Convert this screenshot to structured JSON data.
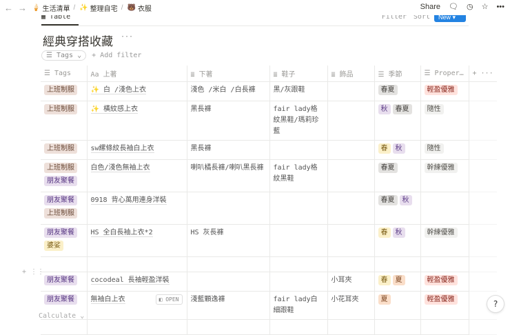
{
  "breadcrumb": [
    {
      "icon": "🍦",
      "label": "生活清單"
    },
    {
      "icon": "✨",
      "label": "整理自宅"
    },
    {
      "icon": "🐻",
      "label": "衣服"
    }
  ],
  "topbar": {
    "share": "Share"
  },
  "view": {
    "tab": "Table",
    "tools": "Filter Sort",
    "new": "New"
  },
  "title": "經典穿搭收藏",
  "filter": {
    "chip": "Tags",
    "add": "+ Add filter"
  },
  "columns": [
    "Tags",
    "上著",
    "下著",
    "鞋子",
    "飾品",
    "季節",
    "Proper…"
  ],
  "rows": [
    {
      "tags": [
        "上班制服"
      ],
      "top": "✨ 白 /淺色上衣",
      "bottom": "淺色 /米白 /白長褲",
      "shoes": "黑/灰跟鞋",
      "acc": "",
      "season": [
        "春夏"
      ],
      "prop": [
        "輕盈優雅"
      ]
    },
    {
      "tags": [
        "上班制服"
      ],
      "top": "✨ 橫紋感上衣",
      "bottom": "黑長褲",
      "shoes": "fair lady格紋黑鞋/瑪莉珍藍",
      "acc": "",
      "season": [
        "秋",
        "春夏"
      ],
      "prop": [
        "隨性"
      ]
    },
    {
      "tags": [
        "上班制服"
      ],
      "top": "sw縲條紋長袖白上衣",
      "bottom": "黑長褲",
      "shoes": "",
      "acc": "",
      "season": [
        "春",
        "秋"
      ],
      "prop": [
        "隨性"
      ]
    },
    {
      "tags": [
        "上班制服",
        "朋友聚餐"
      ],
      "top": "白色/淺色無袖上衣",
      "bottom": "喇叭橘長褲/喇叭黑長褲",
      "shoes": "fair lady格紋黑鞋",
      "acc": "",
      "season": [
        "春夏"
      ],
      "prop": [
        "幹練優雅"
      ]
    },
    {
      "tags": [
        "朋友聚餐",
        "上班制服"
      ],
      "top": "0918 背心萬用連身洋裝",
      "bottom": "",
      "shoes": "",
      "acc": "",
      "season": [
        "春夏",
        "秋"
      ],
      "prop": []
    },
    {
      "tags": [
        "朋友聚餐",
        "婆娑"
      ],
      "top": "HS 全白長袖上衣*2",
      "bottom": "HS 灰長褲",
      "shoes": "",
      "acc": "",
      "season": [
        "春",
        "秋"
      ],
      "prop": [
        "幹練優雅"
      ]
    },
    {
      "tags": [],
      "top": "",
      "bottom": "",
      "shoes": "",
      "acc": "",
      "season": [],
      "prop": []
    },
    {
      "tags": [
        "朋友聚餐"
      ],
      "top": "cocodeal 長袖輕盈洋裝",
      "bottom": "",
      "shoes": "",
      "acc": "小耳夾",
      "season": [
        "春",
        "夏"
      ],
      "prop": [
        "輕盈優雅"
      ]
    },
    {
      "tags": [
        "朋友聚餐"
      ],
      "top": "無袖白上衣",
      "bottom": "淺藍顆逸褲",
      "shoes": "fair lady白細跟鞋",
      "acc": "小花耳夾",
      "season": [
        "夏"
      ],
      "prop": [
        "輕盈優雅"
      ],
      "open": "OPEN"
    },
    {
      "tags": [],
      "top": "",
      "bottom": "",
      "shoes": "",
      "acc": "",
      "season": [],
      "prop": []
    }
  ],
  "tag_colors": {
    "上班制服": "brown",
    "朋友聚餐": "purple",
    "婆娑": "yellow",
    "春夏": "gray",
    "秋": "purple",
    "春": "yellow",
    "夏": "orange",
    "輕盈優雅": "red",
    "隨性": "lgray",
    "幹練優雅": "lgray"
  },
  "footer": {
    "calculate": "Calculate ⌄",
    "help": "?"
  }
}
